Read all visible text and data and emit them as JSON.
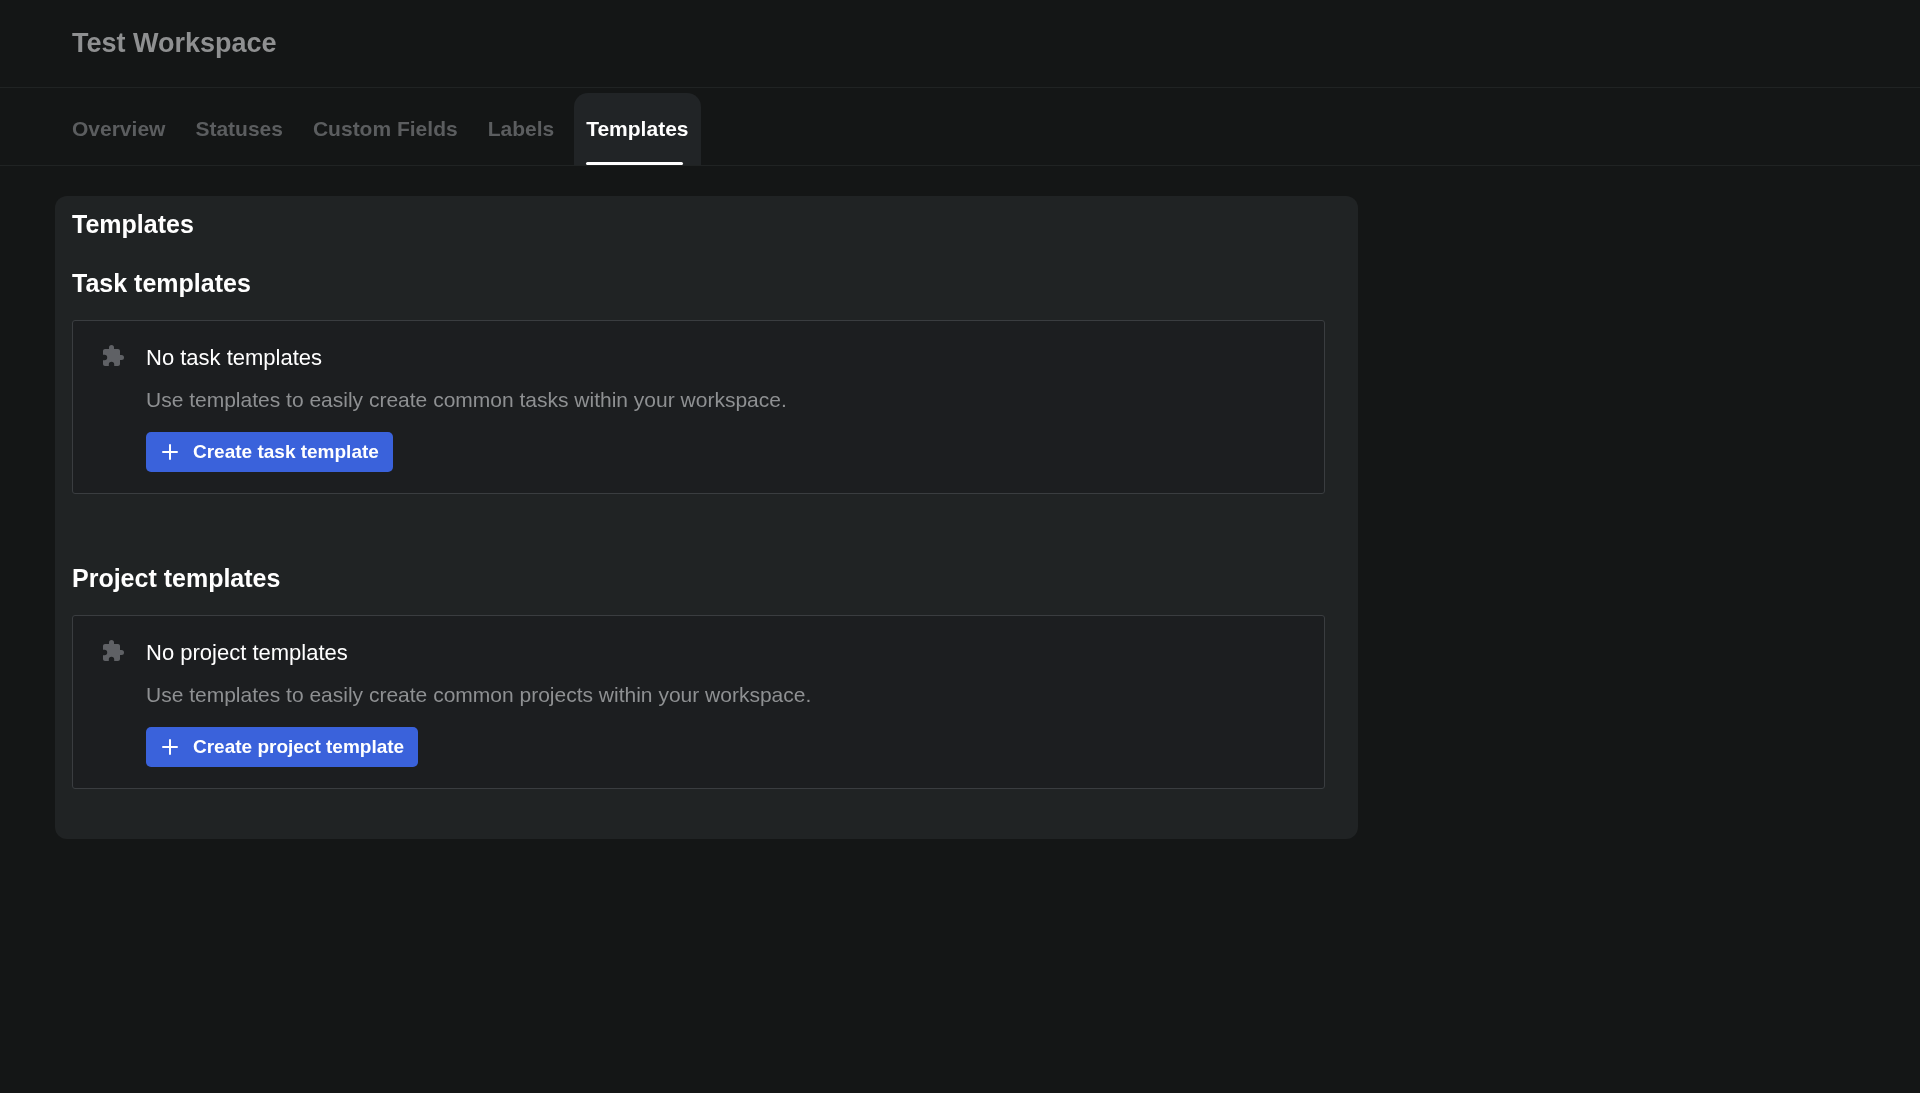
{
  "header": {
    "title": "Test Workspace"
  },
  "tabs": [
    {
      "label": "Overview",
      "selected": false
    },
    {
      "label": "Statuses",
      "selected": false
    },
    {
      "label": "Custom Fields",
      "selected": false
    },
    {
      "label": "Labels",
      "selected": false
    },
    {
      "label": "Templates",
      "selected": true
    }
  ],
  "panel": {
    "title": "Templates",
    "sections": [
      {
        "heading": "Task templates",
        "empty_title": "No task templates",
        "empty_text": "Use templates to easily create common tasks within your workspace.",
        "button": "Create task template"
      },
      {
        "heading": "Project templates",
        "empty_title": "No project templates",
        "empty_text": "Use templates to easily create common projects within your workspace.",
        "button": "Create project template"
      }
    ]
  }
}
